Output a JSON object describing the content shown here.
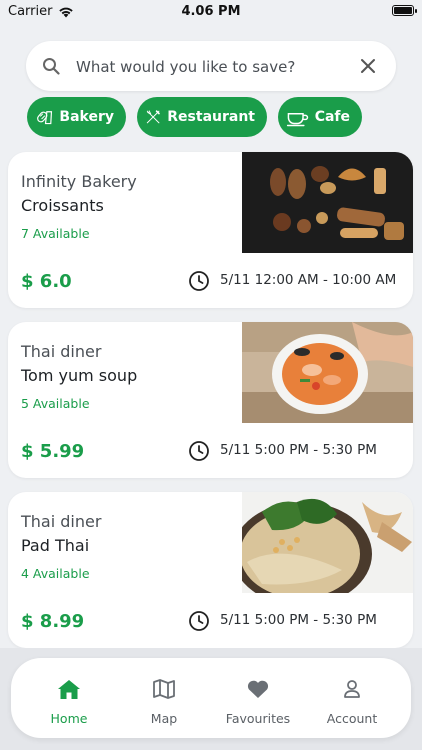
{
  "status_bar": {
    "carrier": "Carrier",
    "time": "4.06 PM"
  },
  "search": {
    "placeholder": "What would you like to save?",
    "value": ""
  },
  "categories": [
    {
      "label": "Bakery",
      "icon": "bread-icon"
    },
    {
      "label": "Restaurant",
      "icon": "fork-knife-icon"
    },
    {
      "label": "Cafe",
      "icon": "coffee-cup-icon"
    }
  ],
  "offers": [
    {
      "store": "Infinity Bakery",
      "item": "Croissants",
      "availability": "7 Available",
      "price": "$ 6.0",
      "pickup_window": "5/11 12:00 AM - 10:00 AM"
    },
    {
      "store": "Thai diner",
      "item": "Tom yum soup",
      "availability": "5 Available",
      "price": "$ 5.99",
      "pickup_window": "5/11 5:00 PM - 5:30 PM"
    },
    {
      "store": "Thai diner",
      "item": "Pad Thai",
      "availability": "4 Available",
      "price": "$ 8.99",
      "pickup_window": "5/11 5:00 PM - 5:30 PM"
    }
  ],
  "bottom_nav": [
    {
      "label": "Home",
      "icon": "home-icon",
      "active": true
    },
    {
      "label": "Map",
      "icon": "map-icon",
      "active": false
    },
    {
      "label": "Favourites",
      "icon": "heart-icon",
      "active": false
    },
    {
      "label": "Account",
      "icon": "person-icon",
      "active": false
    }
  ],
  "colors": {
    "accent": "#1a9d4a",
    "background": "#eef0f3",
    "card": "#ffffff"
  }
}
